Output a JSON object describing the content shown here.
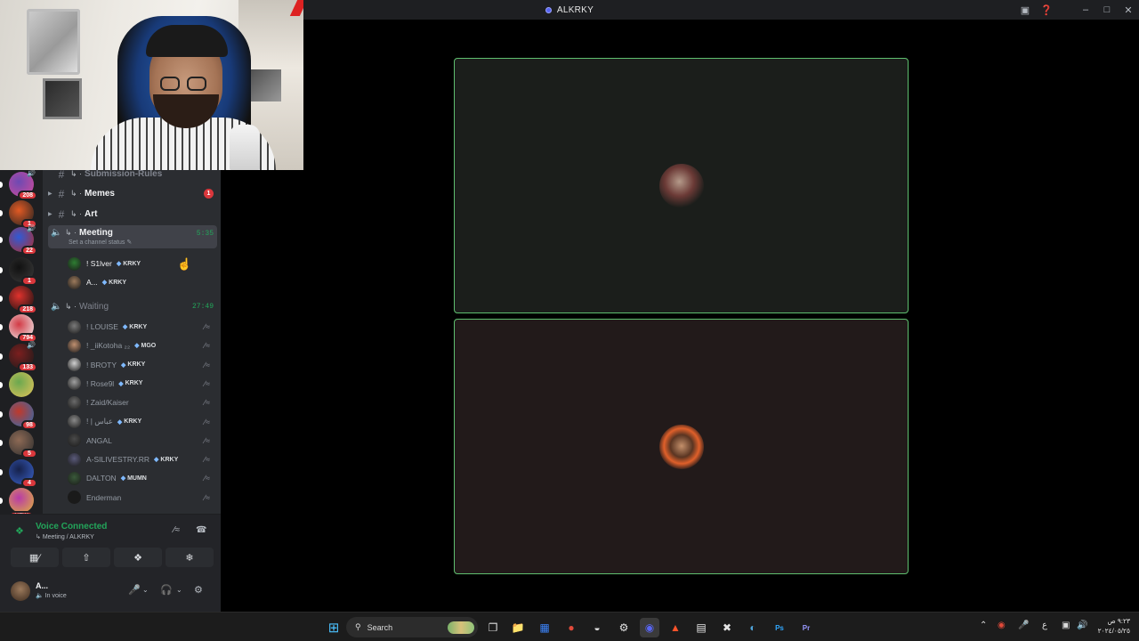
{
  "window": {
    "title": "ALKRKY"
  },
  "servers": [
    {
      "badge": "208",
      "colors": [
        "#6d4ab3",
        "#d04a9a"
      ],
      "voice": true
    },
    {
      "badge": "1",
      "colors": [
        "#e25a23",
        "#222"
      ],
      "voice": false
    },
    {
      "badge": "22",
      "colors": [
        "#2f5ad6",
        "#b02d2d"
      ],
      "voice": true
    },
    {
      "badge": "1",
      "colors": [
        "#111",
        "#3a3a3a"
      ],
      "voice": false
    },
    {
      "badge": "218",
      "colors": [
        "#e0322d",
        "#111"
      ],
      "voice": false
    },
    {
      "badge": "794",
      "colors": [
        "#d23a45",
        "#f0f0f0"
      ],
      "voice": false
    },
    {
      "badge": "133",
      "colors": [
        "#7b1f1f",
        "#1a1a1a"
      ],
      "voice": true
    },
    {
      "badge": "",
      "colors": [
        "#6aa84f",
        "#e3c35a"
      ],
      "voice": false
    },
    {
      "badge": "98",
      "colors": [
        "#c0392b",
        "#2b6cb0"
      ],
      "voice": false
    },
    {
      "badge": "5",
      "colors": [
        "#8e6a55",
        "#2e2e2e"
      ],
      "voice": false
    },
    {
      "badge": "4",
      "colors": [
        "#16214a",
        "#3a62c9"
      ],
      "voice": false
    },
    {
      "badge": "NEW",
      "colors": [
        "#b83aa8",
        "#e0b33a"
      ],
      "voice": false
    }
  ],
  "channels": {
    "submission": "Submission-Rules",
    "memes": {
      "name": "Memes",
      "mentions": "1"
    },
    "art": "Art",
    "meeting": {
      "name": "Meeting",
      "status": "Set a channel status",
      "time": "5:35"
    },
    "meeting_users": [
      {
        "name": "! S1lver",
        "tag": "KRKY",
        "color": "#2e7d32"
      },
      {
        "name": "A...",
        "tag": "KRKY",
        "color": "#9c7a5c"
      }
    ],
    "waiting": {
      "name": "Waiting",
      "time": "27:49"
    },
    "waiting_users": [
      {
        "name": "! LOUISE",
        "tag": "KRKY",
        "color": "#7a7a7a"
      },
      {
        "name": "! _iiKotoha ₂₂",
        "tag": "MGO",
        "color": "#c09070"
      },
      {
        "name": "! BROTY",
        "tag": "KRKY",
        "color": "#d0d0d0"
      },
      {
        "name": "! Rose9l",
        "tag": "KRKY",
        "color": "#a0a0a0"
      },
      {
        "name": "! Zaid/Kaiser",
        "tag": "",
        "color": "#6a6a6a"
      },
      {
        "name": "! | عباس",
        "tag": "KRKY",
        "color": "#8a8a8a"
      },
      {
        "name": "ANGAL",
        "tag": "",
        "color": "#4a4a4a"
      },
      {
        "name": "A-SILIVESTRY.RR",
        "tag": "KRKY",
        "color": "#5a5a7a"
      },
      {
        "name": "DALTON",
        "tag": "MUMN",
        "color": "#3a5a3a"
      },
      {
        "name": "Enderman",
        "tag": "",
        "color": "#1a1a1a"
      }
    ]
  },
  "voice_panel": {
    "status": "Voice Connected",
    "location": "Meeting / ALKRKY"
  },
  "user_panel": {
    "name": "A...",
    "status": "In voice"
  },
  "taskbar": {
    "search": "Search",
    "clock_time": "٩:٢٣ ص",
    "clock_date": "٢٠٢٤/٠٥/٢٥",
    "lang": "ع"
  },
  "taskbar_apps": [
    {
      "icon": "file-explorer-icon",
      "color": "#f5c542",
      "glyph": "📁"
    },
    {
      "icon": "store-icon",
      "color": "#3b82f6",
      "glyph": "▦"
    },
    {
      "icon": "chrome-icon",
      "color": "#e04a3a",
      "glyph": "●"
    },
    {
      "icon": "app-icon",
      "color": "#dcdcdc",
      "glyph": "◒"
    },
    {
      "icon": "steam-client-icon",
      "color": "#e6e6e6",
      "glyph": "⚙"
    },
    {
      "icon": "discord-icon",
      "color": "#5865f2",
      "glyph": "◉"
    },
    {
      "icon": "brave-icon",
      "color": "#fb542b",
      "glyph": "▲"
    },
    {
      "icon": "notes-icon",
      "color": "#e6e6e6",
      "glyph": "▤"
    },
    {
      "icon": "capcut-icon",
      "color": "#e6e6e6",
      "glyph": "✖"
    },
    {
      "icon": "steam-icon",
      "color": "#4fa3d9",
      "glyph": "◐"
    },
    {
      "icon": "photoshop-icon",
      "color": "#31a8ff",
      "glyph": "Ps"
    },
    {
      "icon": "premiere-icon",
      "color": "#9999ff",
      "glyph": "Pr"
    }
  ]
}
